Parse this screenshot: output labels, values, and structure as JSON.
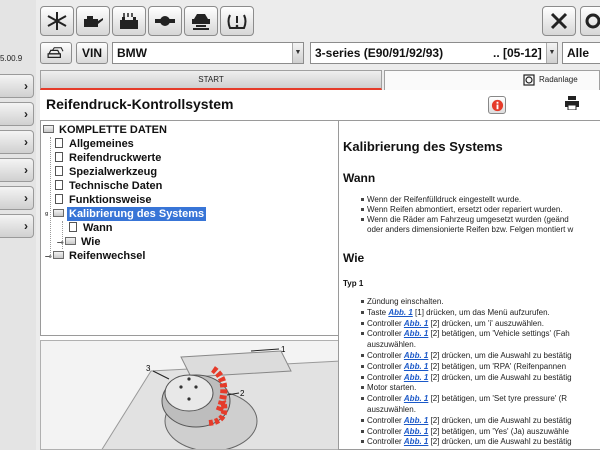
{
  "app": {
    "version": "5.00.9"
  },
  "toolbar": {
    "left_icons": [
      "snowflake-icon",
      "engine-oil-icon",
      "battery-icon",
      "timing-belt-icon",
      "car-lift-icon",
      "tpms-warning-icon"
    ],
    "right_icons": [
      "tools-icon",
      "gear-icon"
    ]
  },
  "selector": {
    "vin_label": "VIN",
    "make": "BMW",
    "model": "3-series (E90/91/92/93)",
    "years": ".. [05-12]",
    "engine": "Alle"
  },
  "tabs": {
    "start": "START",
    "radanlage": "Radanlage"
  },
  "page": {
    "title": "Reifendruck-Kontrollsystem"
  },
  "tree": {
    "root": "KOMPLETTE DATEN",
    "items": [
      "Allgemeines",
      "Reifendruckwerte",
      "Spezialwerkzeug",
      "Technische Daten",
      "Funktionsweise",
      "Kalibrierung des Systems",
      "Wann",
      "Wie",
      "Reifenwechsel"
    ]
  },
  "illustration": {
    "callouts": [
      "1",
      "2",
      "3"
    ]
  },
  "doc": {
    "title": "Kalibrierung des Systems",
    "section1": "Wann",
    "wann_bullets": [
      "Wenn der Reifenfülldruck eingestellt wurde.",
      "Wenn Reifen abmontiert, ersetzt oder repariert wurden.",
      "Wenn die Räder am Fahrzeug umgesetzt wurden (geänd"
    ],
    "wann_cont": "oder anders dimensionierte Reifen bzw. Felgen montiert w",
    "section2": "Wie",
    "typ": "Typ 1",
    "abb_label": "Abb. 1",
    "wie_steps": [
      {
        "pre": "Zündung einschalten.",
        "abb": false,
        "post": ""
      },
      {
        "pre": "Taste ",
        "abb": true,
        "post": " [1] drücken, um das Menü aufzurufen."
      },
      {
        "pre": "Controller ",
        "abb": true,
        "post": " [2] drücken, um 'i' auszuwählen."
      },
      {
        "pre": "Controller ",
        "abb": true,
        "post": " [2] betätigen, um 'Vehicle settings' (Fah"
      },
      {
        "pre": "auszuwählen.",
        "abb": false,
        "post": "",
        "cont": true
      },
      {
        "pre": "Controller ",
        "abb": true,
        "post": " [2] drücken, um die Auswahl zu bestätig"
      },
      {
        "pre": "Controller ",
        "abb": true,
        "post": " [2] betätigen, um 'RPA' (Reifenpannen"
      },
      {
        "pre": "Controller ",
        "abb": true,
        "post": " [2] drücken, um die Auswahl zu bestätig"
      },
      {
        "pre": "Motor starten.",
        "abb": false,
        "post": ""
      },
      {
        "pre": "Controller ",
        "abb": true,
        "post": " [2] betätigen, um 'Set tyre pressure' (R"
      },
      {
        "pre": "auszuwählen.",
        "abb": false,
        "post": "",
        "cont": true
      },
      {
        "pre": "Controller ",
        "abb": true,
        "post": " [2] drücken, um die Auswahl zu bestätig"
      },
      {
        "pre": "Controller ",
        "abb": true,
        "post": " [2] betätigen, um 'Yes' (Ja) auszuwähle"
      },
      {
        "pre": "Controller ",
        "abb": true,
        "post": " [2] drücken, um die Auswahl zu bestätig"
      }
    ]
  }
}
